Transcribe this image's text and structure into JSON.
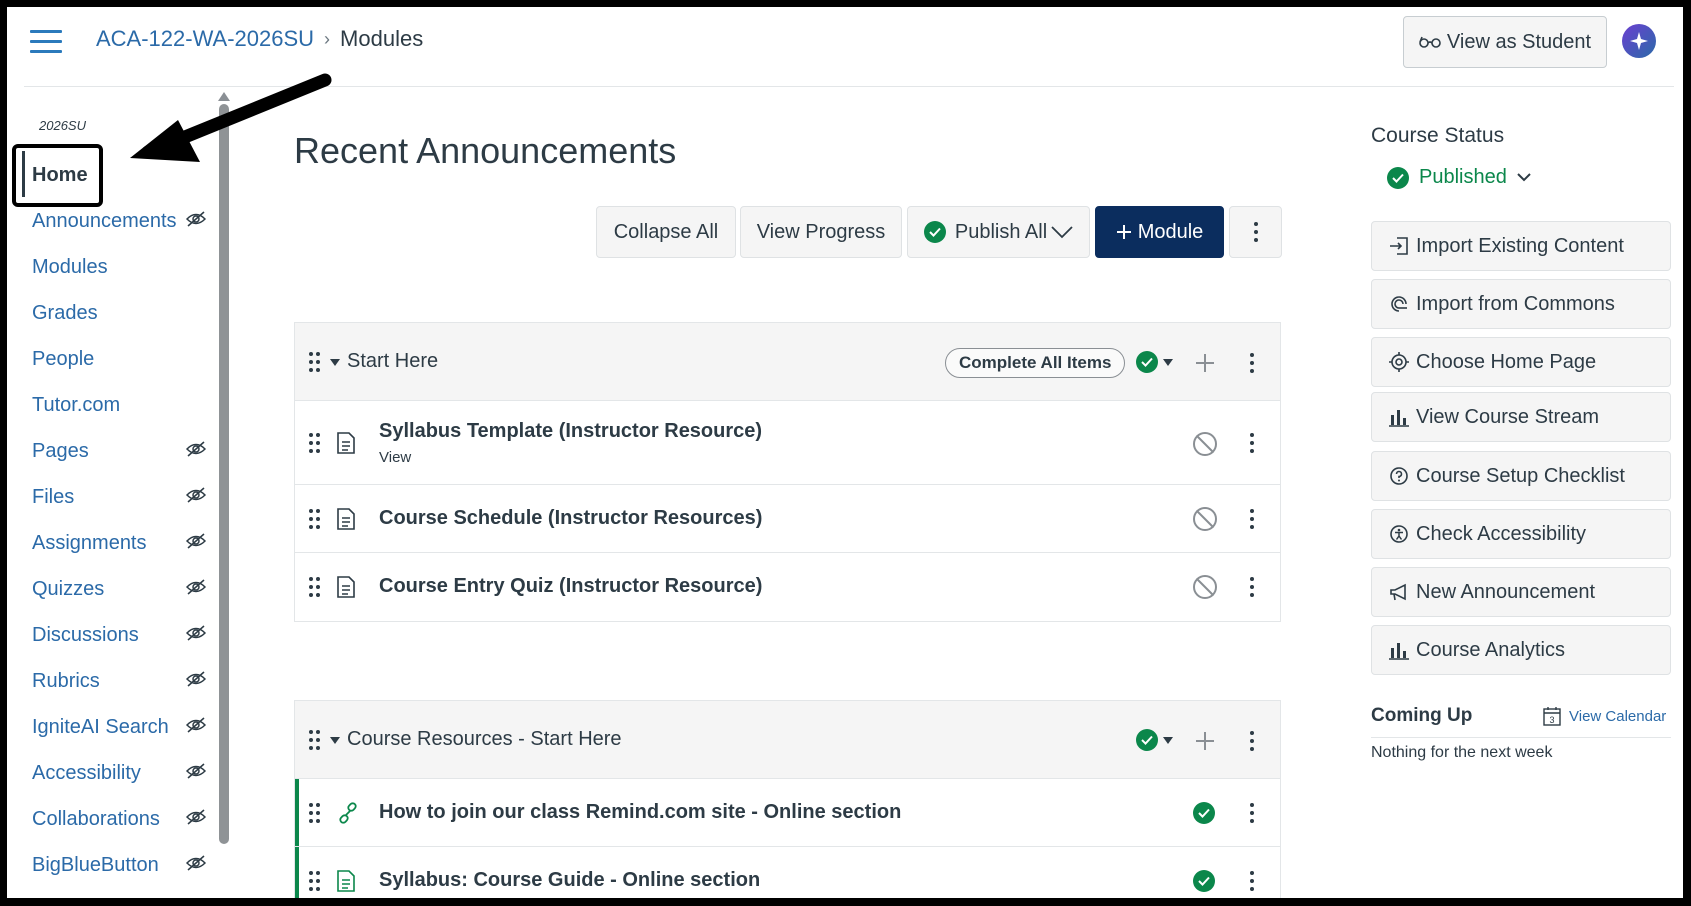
{
  "header": {
    "course_code": "ACA-122-WA-2026SU",
    "separator": "›",
    "current_page": "Modules",
    "view_as_student": "View as Student"
  },
  "nav": {
    "term": "2026SU",
    "items": [
      {
        "label": "Home",
        "hidden": false,
        "active": true
      },
      {
        "label": "Announcements",
        "hidden": true
      },
      {
        "label": "Modules",
        "hidden": false
      },
      {
        "label": "Grades",
        "hidden": false
      },
      {
        "label": "People",
        "hidden": false
      },
      {
        "label": "Tutor.com",
        "hidden": false
      },
      {
        "label": "Pages",
        "hidden": true
      },
      {
        "label": "Files",
        "hidden": true
      },
      {
        "label": "Assignments",
        "hidden": true
      },
      {
        "label": "Quizzes",
        "hidden": true
      },
      {
        "label": "Discussions",
        "hidden": true
      },
      {
        "label": "Rubrics",
        "hidden": true
      },
      {
        "label": "IgniteAI Search",
        "hidden": true
      },
      {
        "label": "Accessibility",
        "hidden": true
      },
      {
        "label": "Collaborations",
        "hidden": true
      },
      {
        "label": "BigBlueButton",
        "hidden": true
      }
    ]
  },
  "main": {
    "title": "Recent Announcements",
    "toolbar": {
      "collapse_all": "Collapse All",
      "view_progress": "View Progress",
      "publish_all": "Publish All",
      "add_module": "Module"
    },
    "modules": [
      {
        "title": "Start Here",
        "requirement": "Complete All Items",
        "items": [
          {
            "title": "Syllabus Template (Instructor Resource)",
            "subtitle": "View",
            "icon": "document-icon",
            "published": false
          },
          {
            "title": "Course Schedule (Instructor Resources)",
            "icon": "document-icon",
            "published": false
          },
          {
            "title": "Course Entry Quiz (Instructor Resource)",
            "icon": "document-icon",
            "published": false
          }
        ]
      },
      {
        "title": "Course Resources - Start Here",
        "items": [
          {
            "title": "How to join our class Remind.com site - Online section",
            "icon": "link-icon",
            "published": true
          },
          {
            "title": "Syllabus: Course Guide - Online section",
            "icon": "document-icon",
            "published": true
          }
        ]
      }
    ]
  },
  "sidebar": {
    "status_title": "Course Status",
    "status_value": "Published",
    "buttons": [
      {
        "label": "Import Existing Content",
        "icon": "import-icon"
      },
      {
        "label": "Import from Commons",
        "icon": "commons-icon"
      },
      {
        "label": "Choose Home Page",
        "icon": "target-icon"
      },
      {
        "label": "View Course Stream",
        "icon": "bar-chart-icon"
      },
      {
        "label": "Course Setup Checklist",
        "icon": "question-icon"
      },
      {
        "label": "Check Accessibility",
        "icon": "accessibility-icon"
      },
      {
        "label": "New Announcement",
        "icon": "megaphone-icon"
      },
      {
        "label": "Course Analytics",
        "icon": "bar-chart-icon"
      }
    ],
    "coming_up": "Coming Up",
    "view_calendar": "View Calendar",
    "calendar_day": "3",
    "nothing": "Nothing for the next week"
  },
  "colors": {
    "link": "#2b6aa8",
    "primary": "#0b2d5e",
    "success": "#0b874b",
    "text": "#2d3b45"
  }
}
